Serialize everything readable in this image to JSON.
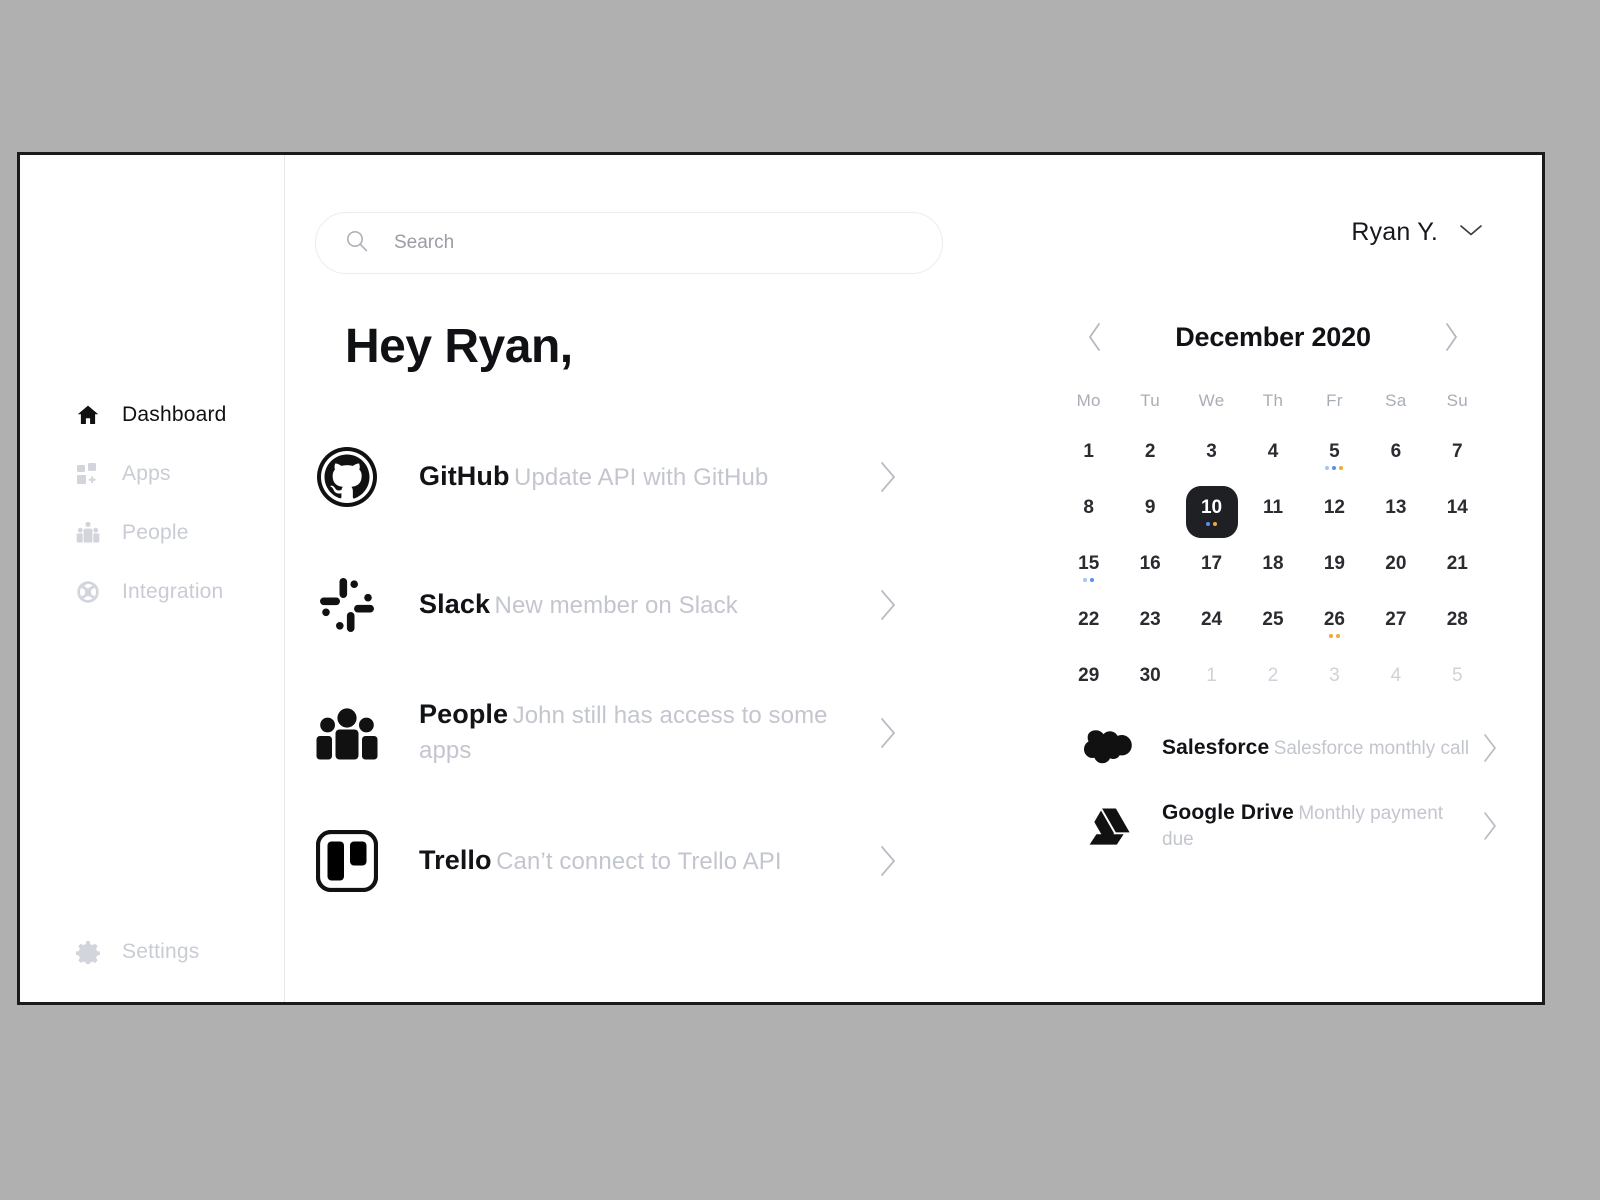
{
  "window": {
    "border_color": "#1b1b1b",
    "page_background": "#b0b0b0"
  },
  "sidebar": {
    "items": [
      {
        "label": "Dashboard",
        "icon": "home-icon",
        "active": true
      },
      {
        "label": "Apps",
        "icon": "apps-icon",
        "active": false
      },
      {
        "label": "People",
        "icon": "people-icon",
        "active": false
      },
      {
        "label": "Integration",
        "icon": "integration-icon",
        "active": false
      }
    ],
    "footer": {
      "label": "Settings",
      "icon": "gear-icon"
    }
  },
  "topbar": {
    "search": {
      "placeholder": "Search",
      "value": "",
      "icon": "search-icon"
    },
    "user": {
      "name": "Ryan Y.",
      "icon": "chevron-down-icon"
    }
  },
  "main": {
    "greeting": "Hey Ryan,",
    "apps": [
      {
        "name": "GitHub",
        "message": "Update API with GitHub",
        "icon": "github-icon",
        "chevron": "chevron-right-icon"
      },
      {
        "name": "Slack",
        "message": "New member on Slack",
        "icon": "slack-icon",
        "chevron": "chevron-right-icon"
      },
      {
        "name": "People",
        "message": "John still has access to some apps",
        "icon": "people-group-icon",
        "chevron": "chevron-right-icon"
      },
      {
        "name": "Trello",
        "message": "Can’t connect to Trello API",
        "icon": "trello-icon",
        "chevron": "chevron-right-icon"
      }
    ]
  },
  "calendar": {
    "title": "December 2020",
    "prev_icon": "chevron-left-icon",
    "next_icon": "chevron-right-icon",
    "weekdays": [
      "Mo",
      "Tu",
      "We",
      "Th",
      "Fr",
      "Sa",
      "Su"
    ],
    "selected_day": 10,
    "dot_colors": {
      "blue": "#5b8def",
      "light_blue": "#a9c3f5",
      "orange": "#f2a93b"
    },
    "weeks": [
      [
        {
          "day": "1",
          "muted": false,
          "dots": []
        },
        {
          "day": "2",
          "muted": false,
          "dots": []
        },
        {
          "day": "3",
          "muted": false,
          "dots": []
        },
        {
          "day": "4",
          "muted": false,
          "dots": []
        },
        {
          "day": "5",
          "muted": false,
          "dots": [
            "#a9c3f5",
            "#5b8def",
            "#f2a93b"
          ]
        },
        {
          "day": "6",
          "muted": false,
          "dots": []
        },
        {
          "day": "7",
          "muted": false,
          "dots": []
        }
      ],
      [
        {
          "day": "8",
          "muted": false,
          "dots": []
        },
        {
          "day": "9",
          "muted": false,
          "dots": []
        },
        {
          "day": "10",
          "muted": false,
          "selected": true,
          "dots": [
            "#5b8def",
            "#f2a93b"
          ]
        },
        {
          "day": "11",
          "muted": false,
          "dots": []
        },
        {
          "day": "12",
          "muted": false,
          "dots": []
        },
        {
          "day": "13",
          "muted": false,
          "dots": []
        },
        {
          "day": "14",
          "muted": false,
          "dots": []
        }
      ],
      [
        {
          "day": "15",
          "muted": false,
          "dots": [
            "#a9c3f5",
            "#5b8def"
          ]
        },
        {
          "day": "16",
          "muted": false,
          "dots": []
        },
        {
          "day": "17",
          "muted": false,
          "dots": []
        },
        {
          "day": "18",
          "muted": false,
          "dots": []
        },
        {
          "day": "19",
          "muted": false,
          "dots": []
        },
        {
          "day": "20",
          "muted": false,
          "dots": []
        },
        {
          "day": "21",
          "muted": false,
          "dots": []
        }
      ],
      [
        {
          "day": "22",
          "muted": false,
          "dots": []
        },
        {
          "day": "23",
          "muted": false,
          "dots": []
        },
        {
          "day": "24",
          "muted": false,
          "dots": []
        },
        {
          "day": "25",
          "muted": false,
          "dots": []
        },
        {
          "day": "26",
          "muted": false,
          "dots": [
            "#f2a93b",
            "#f2a93b"
          ]
        },
        {
          "day": "27",
          "muted": false,
          "dots": []
        },
        {
          "day": "28",
          "muted": false,
          "dots": []
        }
      ],
      [
        {
          "day": "29",
          "muted": false,
          "dots": []
        },
        {
          "day": "30",
          "muted": false,
          "dots": []
        },
        {
          "day": "1",
          "muted": true,
          "dots": []
        },
        {
          "day": "2",
          "muted": true,
          "dots": []
        },
        {
          "day": "3",
          "muted": true,
          "dots": []
        },
        {
          "day": "4",
          "muted": true,
          "dots": []
        },
        {
          "day": "5",
          "muted": true,
          "dots": []
        }
      ]
    ]
  },
  "events": [
    {
      "name": "Salesforce",
      "detail": "Salesforce monthly call",
      "icon": "salesforce-icon",
      "chevron": "chevron-right-icon"
    },
    {
      "name": "Google Drive",
      "detail": "Monthly payment due",
      "icon": "google-drive-icon",
      "chevron": "chevron-right-icon"
    }
  ]
}
